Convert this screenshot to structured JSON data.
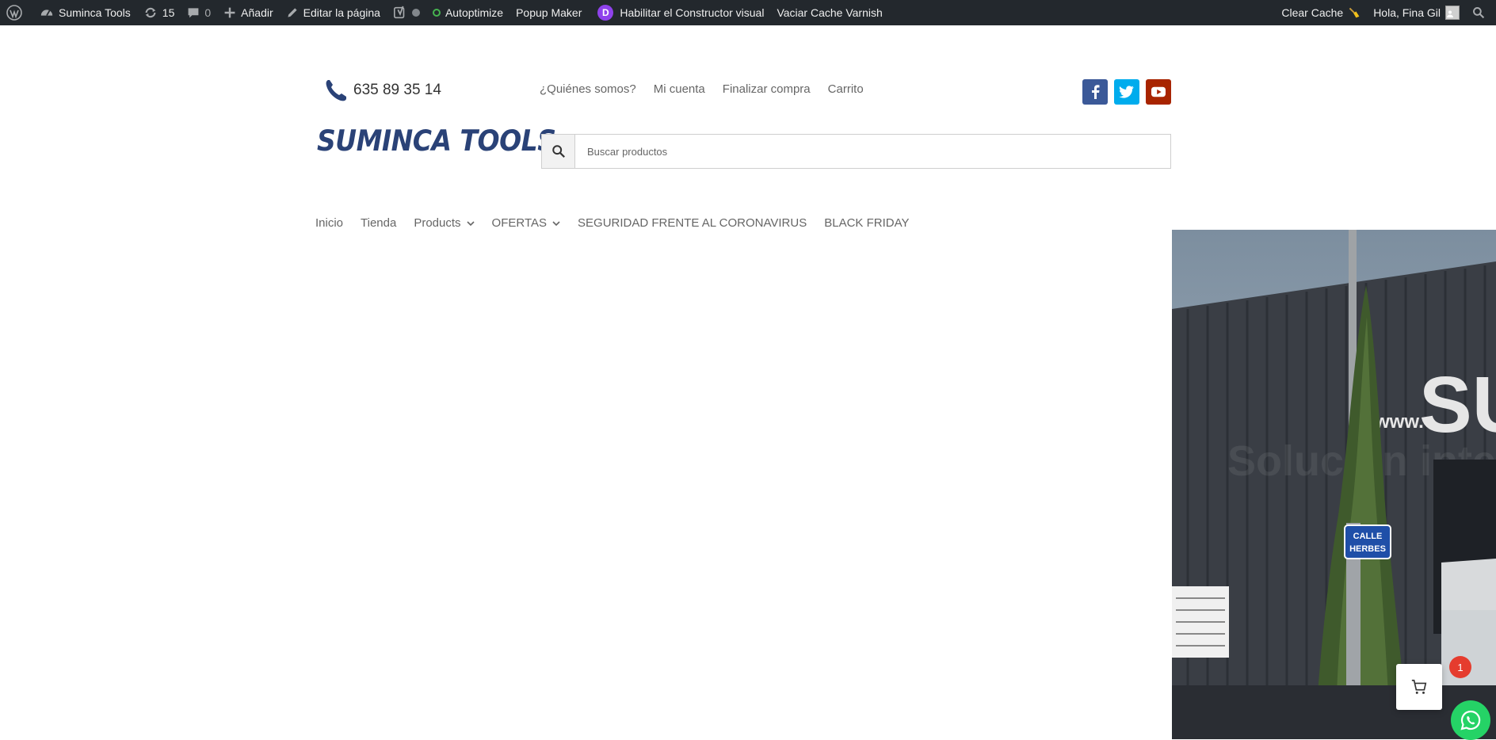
{
  "adminbar": {
    "site_name": "Suminca Tools",
    "updates_count": "15",
    "comments_count": "0",
    "add_new": "Añadir",
    "edit_page": "Editar la página",
    "autoptimize": "Autoptimize",
    "popup_maker": "Popup Maker",
    "divi_badge": "D",
    "visual_builder": "Habilitar el Constructor visual",
    "varnish": "Vaciar Cache Varnish",
    "clear_cache": "Clear Cache",
    "greeting": "Hola, Fina Gil"
  },
  "header": {
    "phone": "635 89 35 14",
    "top_links": [
      "¿Quiénes somos?",
      "Mi cuenta",
      "Finalizar compra",
      "Carrito"
    ],
    "logo_text": "SUMINCA TOOLS",
    "search_placeholder": "Buscar productos"
  },
  "main_nav": [
    "Inicio",
    "Tienda",
    "Products",
    "OFERTAS",
    "SEGURIDAD FRENTE AL CORONAVIRUS",
    "BLACK FRIDAY"
  ],
  "photo": {
    "web_prefix": "www.",
    "sign_text": "SU",
    "slogan": "Solución integral",
    "street_sign_1": "CALLE",
    "street_sign_2": "HERBES"
  },
  "cart": {
    "count": "1"
  },
  "colors": {
    "adminbar_bg": "#23282d",
    "logo": "#2a4277",
    "facebook": "#3b5998",
    "twitter": "#00aced",
    "youtube": "#a82400",
    "cart_badge": "#e53c2e",
    "whatsapp": "#25d366"
  }
}
